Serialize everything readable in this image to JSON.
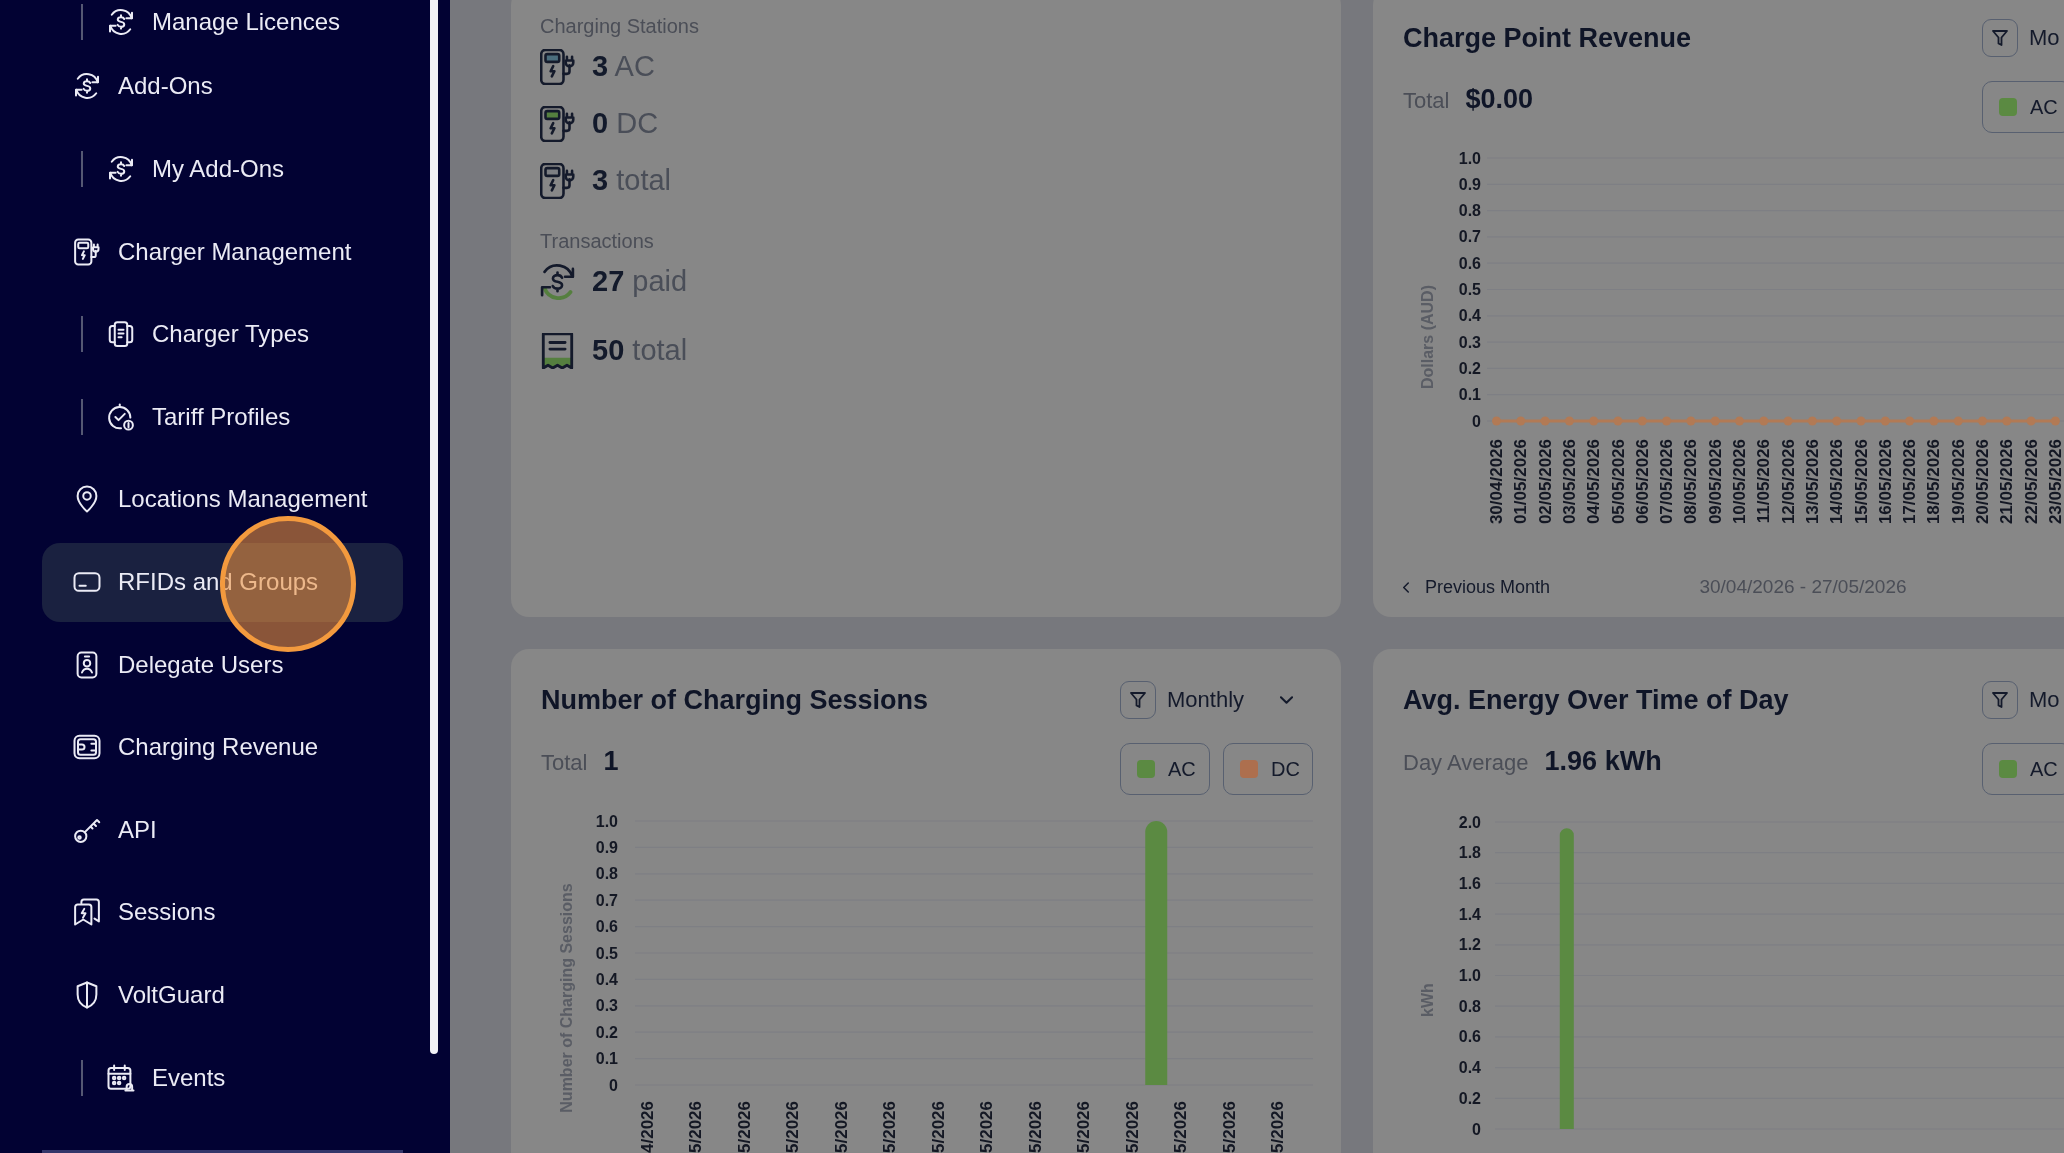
{
  "sidebar": {
    "leading_children": [
      {
        "label": "Manage Licences",
        "selected": false
      }
    ],
    "items": [
      {
        "label": "Add-Ons",
        "selected": false,
        "children": [
          {
            "label": "My Add-Ons",
            "selected": false
          }
        ]
      },
      {
        "label": "Charger Management",
        "selected": false,
        "children": [
          {
            "label": "Charger Types",
            "selected": false
          },
          {
            "label": "Tariff Profiles",
            "selected": false
          }
        ]
      },
      {
        "label": "Locations Management",
        "selected": false
      },
      {
        "label": "RFIDs and Groups",
        "selected": true
      },
      {
        "label": "Delegate Users",
        "selected": false
      },
      {
        "label": "Charging Revenue",
        "selected": false
      },
      {
        "label": "API",
        "selected": false
      },
      {
        "label": "Sessions",
        "selected": false
      },
      {
        "label": "VoltGuard",
        "selected": false,
        "children": [
          {
            "label": "Events",
            "selected": false
          }
        ]
      }
    ]
  },
  "summary_card": {
    "charging_stations": {
      "heading": "Charging Stations",
      "rows": [
        {
          "count": "3",
          "unit": "AC"
        },
        {
          "count": "0",
          "unit": "DC"
        },
        {
          "count": "3",
          "unit": "total"
        }
      ]
    },
    "transactions": {
      "heading": "Transactions",
      "rows": [
        {
          "count": "27",
          "unit": "paid"
        },
        {
          "count": "50",
          "unit": "total"
        }
      ]
    }
  },
  "charge_point_revenue": {
    "title": "Charge Point Revenue",
    "period_select": {
      "value": "Mo"
    },
    "summary_label": "Total",
    "summary_value": "$0.00",
    "legend": [
      {
        "label": "AC",
        "color": "#5b8a42"
      }
    ],
    "chart_data": {
      "type": "line",
      "ylabel": "Dollars (AUD)",
      "categories": [
        "30/04/2026",
        "01/05/2026",
        "02/05/2026",
        "03/05/2026",
        "04/05/2026",
        "05/05/2026",
        "06/05/2026",
        "07/05/2026",
        "08/05/2026",
        "09/05/2026",
        "10/05/2026",
        "11/05/2026",
        "12/05/2026",
        "13/05/2026",
        "14/05/2026",
        "15/05/2026",
        "16/05/2026",
        "17/05/2026",
        "18/05/2026",
        "19/05/2026",
        "20/05/2026",
        "21/05/2026",
        "22/05/2026",
        "23/05/2026"
      ],
      "series": [
        {
          "color": "#b27a55",
          "marker": true,
          "values": [
            0,
            0,
            0,
            0,
            0,
            0,
            0,
            0,
            0,
            0,
            0,
            0,
            0,
            0,
            0,
            0,
            0,
            0,
            0,
            0,
            0,
            0,
            0,
            0
          ]
        }
      ],
      "ylim": [
        0,
        1
      ],
      "yticks": [
        0,
        0.1,
        0.2,
        0.3,
        0.4,
        0.5,
        0.6,
        0.7,
        0.8,
        0.9,
        {
          "value": 1,
          "label": "1.0"
        }
      ],
      "grid": true
    },
    "footer": {
      "previous_button": "Previous Month",
      "date_range": "30/04/2026 - 27/05/2026"
    }
  },
  "charging_sessions": {
    "title": "Number of Charging Sessions",
    "period_select": {
      "value": "Monthly"
    },
    "summary_label": "Total",
    "summary_value": "1",
    "chart_data": {
      "type": "bar",
      "ylabel": "Number of Charging Sessions",
      "categories": [
        "4/2026",
        null,
        "5/2026",
        null,
        "5/2026",
        null,
        "5/2026",
        null,
        "5/2026",
        null,
        "5/2026",
        null,
        "5/2026",
        null,
        "5/2026",
        null,
        "5/2026",
        null,
        "5/2026",
        null,
        "5/2026",
        null,
        "5/2026",
        null,
        "5/2026",
        null,
        "5/2026",
        null
      ],
      "series": [
        {
          "name": "AC",
          "color": "#5b8a42",
          "values": [
            0,
            0,
            0,
            0,
            0,
            0,
            0,
            0,
            0,
            0,
            0,
            0,
            0,
            0,
            0,
            0,
            0,
            0,
            0,
            0,
            0,
            1,
            0,
            0,
            0,
            0,
            0,
            0
          ]
        },
        {
          "name": "DC",
          "color": "#ad6f4e",
          "values": [
            0,
            0,
            0,
            0,
            0,
            0,
            0,
            0,
            0,
            0,
            0,
            0,
            0,
            0,
            0,
            0,
            0,
            0,
            0,
            0,
            0,
            0,
            0,
            0,
            0,
            0,
            0,
            0
          ]
        }
      ],
      "ylim": [
        0,
        1
      ],
      "yticks": [
        0,
        0.1,
        0.2,
        0.3,
        0.4,
        0.5,
        0.6,
        0.7,
        0.8,
        0.9,
        {
          "value": 1,
          "label": "1.0"
        }
      ],
      "grid": true
    }
  },
  "energy_by_time_of_day": {
    "title": "Avg. Energy Over Time of Day",
    "period_select": {
      "value": "Mo"
    },
    "summary_label": "Day Average",
    "summary_value": "1.96 kWh",
    "chart_data": {
      "type": "bar",
      "ylabel": "kWh",
      "categories": [
        null,
        null,
        null,
        null,
        null,
        null,
        null,
        null,
        null,
        null,
        null,
        null,
        null,
        null,
        null,
        null,
        null,
        null,
        null,
        null
      ],
      "series": [
        {
          "name": "AC",
          "color": "#5b8a42",
          "values": [
            0,
            0,
            1.96,
            0,
            0,
            0,
            0,
            0,
            0,
            0,
            0,
            0,
            0,
            0,
            0,
            0,
            0,
            0,
            0,
            0
          ]
        }
      ],
      "ylim": [
        0,
        2
      ],
      "yticks": [
        0,
        0.2,
        0.4,
        0.6,
        0.8,
        {
          "value": 1,
          "label": "1.0"
        },
        1.2,
        1.4,
        1.6,
        1.8,
        {
          "value": 2,
          "label": "2.0"
        }
      ],
      "grid": true
    }
  }
}
